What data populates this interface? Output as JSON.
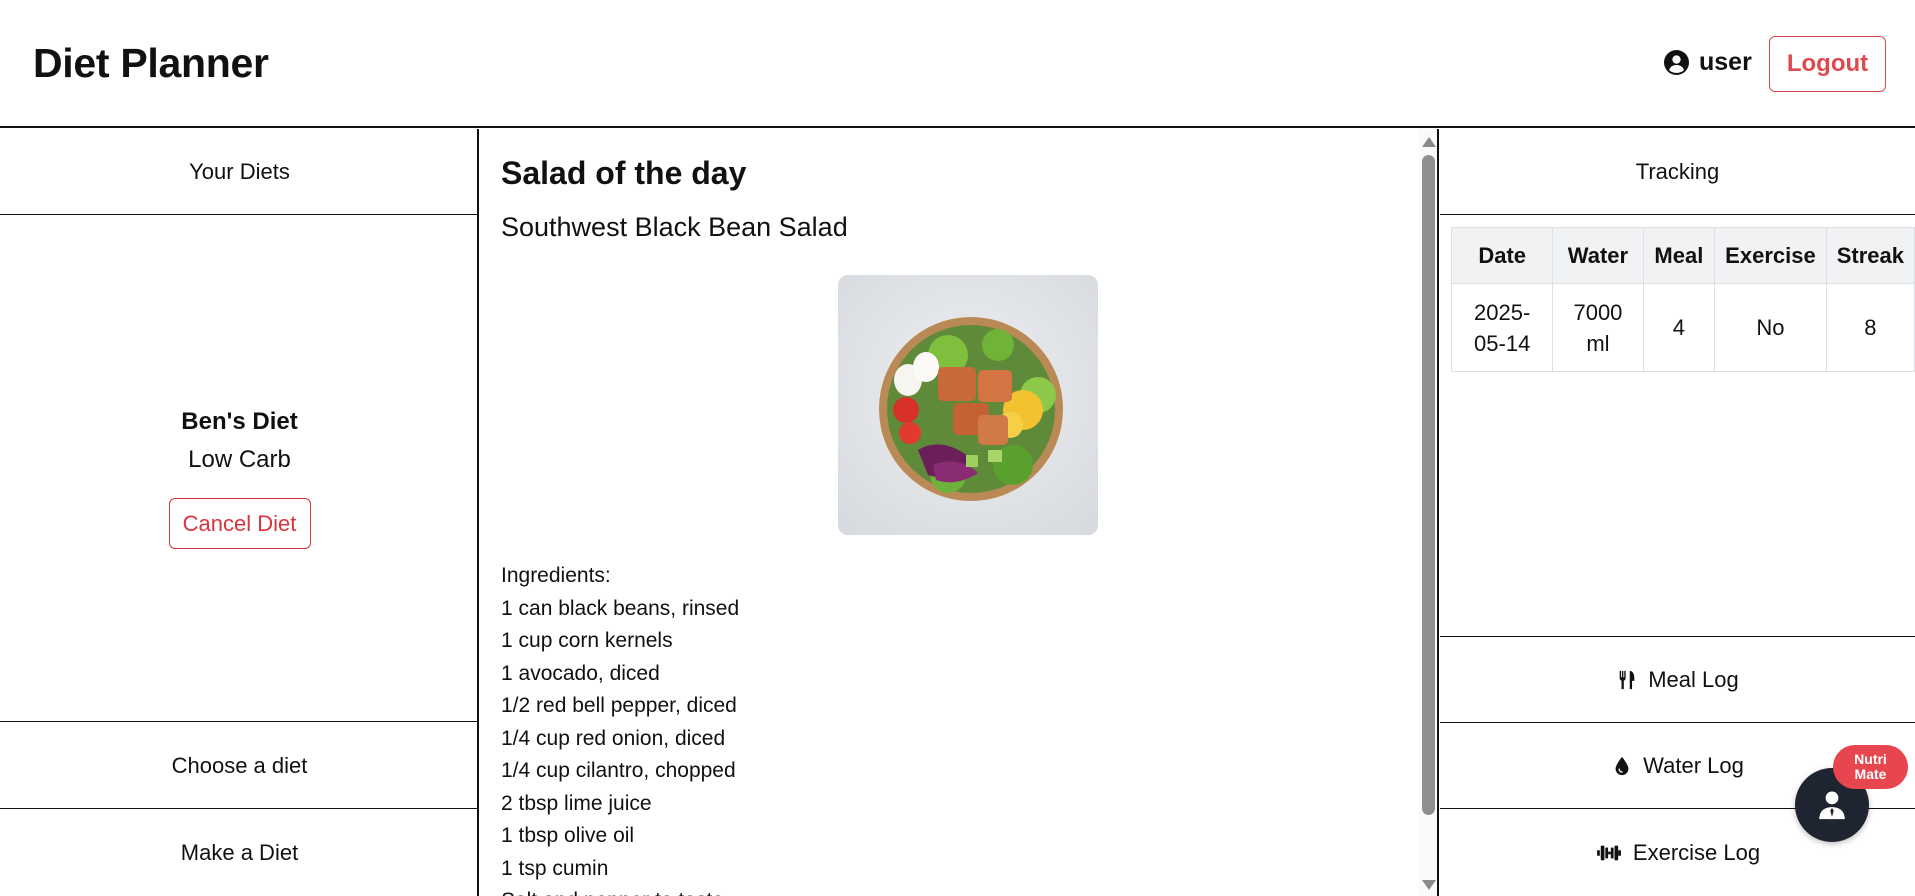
{
  "header": {
    "app_title": "Diet Planner",
    "user_icon": "user-circle-icon",
    "username": "user",
    "logout_label": "Logout"
  },
  "left_panel": {
    "your_diets_label": "Your Diets",
    "diet": {
      "name": "Ben's Diet",
      "type": "Low Carb",
      "cancel_label": "Cancel Diet"
    },
    "choose_diet_label": "Choose a diet",
    "make_diet_label": "Make a Diet"
  },
  "main": {
    "heading": "Salad of the day",
    "salad_name": "Southwest Black Bean Salad",
    "image_alt": "salad-bowl-image",
    "ingredients_label": "Ingredients:",
    "ingredients": [
      "1 can black beans, rinsed",
      "1 cup corn kernels",
      "1 avocado, diced",
      "1/2 red bell pepper, diced",
      "1/4 cup red onion, diced",
      "1/4 cup cilantro, chopped",
      "2 tbsp lime juice",
      "1 tbsp olive oil",
      "1 tsp cumin",
      "Salt and pepper to taste"
    ]
  },
  "tracking": {
    "title": "Tracking",
    "columns": [
      "Date",
      "Water",
      "Meal",
      "Exercise",
      "Streak"
    ],
    "rows": [
      {
        "date": "2025-05-14",
        "water": "7000 ml",
        "meal": "4",
        "exercise": "No",
        "streak": "8"
      }
    ],
    "meal_log_label": "Meal Log",
    "meal_log_icon": "utensils-icon",
    "water_log_label": "Water Log",
    "water_log_icon": "droplet-icon",
    "exercise_log_label": "Exercise Log",
    "exercise_log_icon": "dumbbell-icon"
  },
  "chatbot": {
    "badge_line1": "Nutri",
    "badge_line2": "Mate",
    "icon": "user-tie-icon"
  },
  "colors": {
    "accent_red": "#e04850",
    "cancel_red": "#d9343e",
    "fab_dark": "#1e2430",
    "table_header_bg": "#f1f2f4"
  }
}
